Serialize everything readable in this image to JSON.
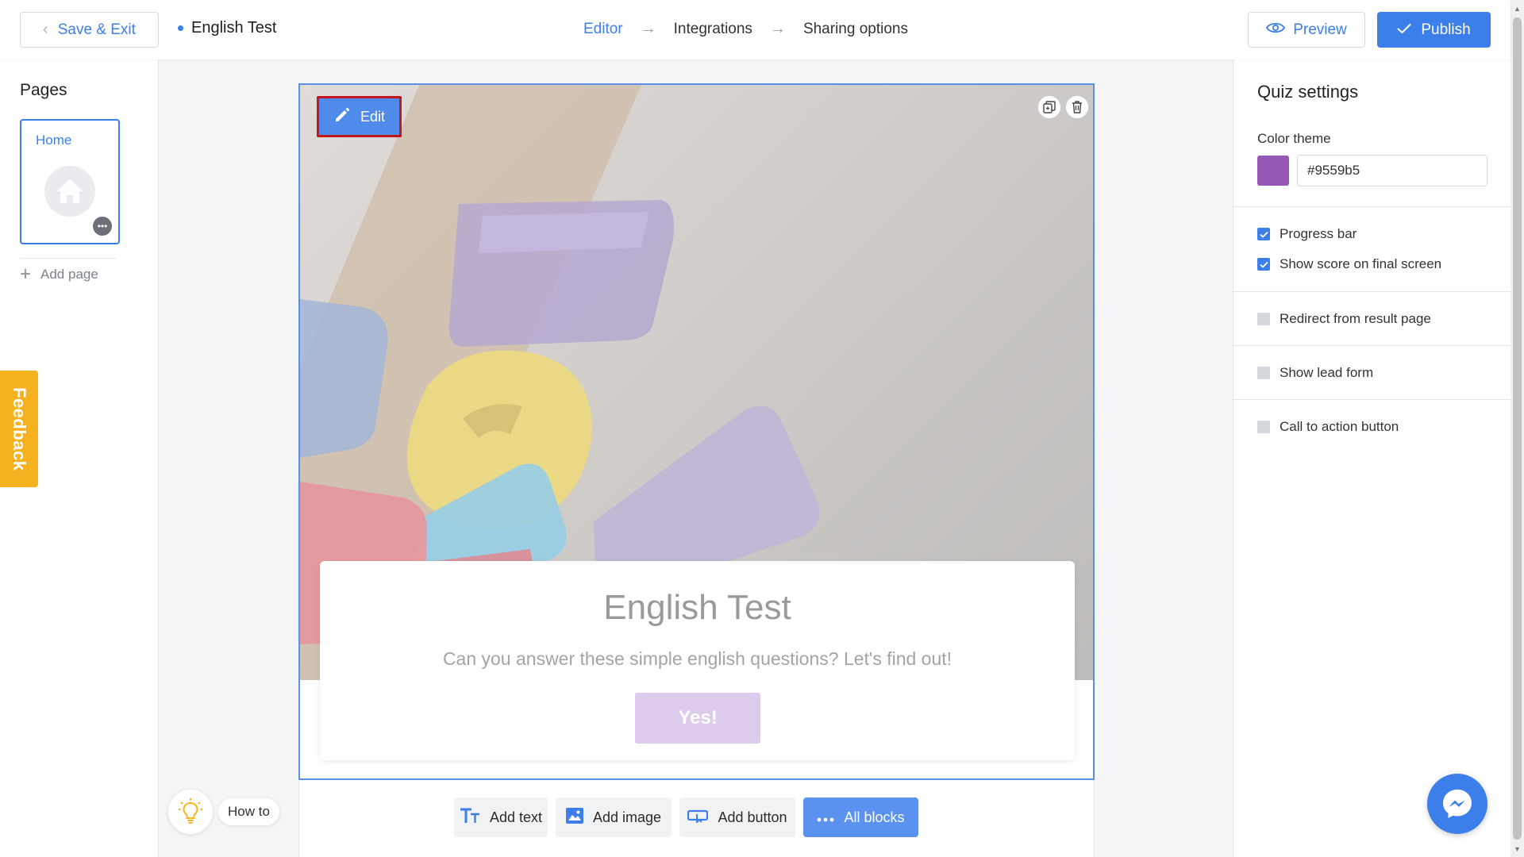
{
  "header": {
    "save_exit": "Save & Exit",
    "quiz_name": "English Test",
    "steps": [
      "Editor",
      "Integrations",
      "Sharing options"
    ],
    "preview": "Preview",
    "publish": "Publish"
  },
  "pages": {
    "title": "Pages",
    "items": [
      {
        "label": "Home"
      }
    ],
    "add_page": "Add page"
  },
  "feedback": "Feedback",
  "howto": "How to",
  "block": {
    "edit": "Edit",
    "title": "English Test",
    "subtitle": "Can you answer these simple english questions? Let's find out!",
    "button": "Yes!"
  },
  "toolbar": {
    "add_text": "Add text",
    "add_image": "Add image",
    "add_button": "Add button",
    "all_blocks": "All blocks"
  },
  "settings": {
    "title": "Quiz settings",
    "color_label": "Color theme",
    "color_value": "#9559b5",
    "options": [
      {
        "label": "Progress bar",
        "checked": true
      },
      {
        "label": "Show score on final screen",
        "checked": true
      },
      {
        "label": "Redirect from result page",
        "checked": false
      },
      {
        "label": "Show lead form",
        "checked": false
      },
      {
        "label": "Call to action button",
        "checked": false
      }
    ]
  },
  "colors": {
    "accent": "#3c7fea",
    "edit_outline": "#c4161c",
    "feedback": "#f6b21e",
    "theme": "#9559b5",
    "yes_button": "#dccbec"
  },
  "icons": {
    "back": "chevron-left-icon",
    "arrow": "arrow-right-icon",
    "preview": "eye-icon",
    "publish": "check-icon",
    "edit": "pencil-icon",
    "duplicate": "duplicate-icon",
    "delete": "trash-icon",
    "home": "home-icon",
    "more": "more-icon",
    "add": "plus-icon",
    "bulb": "lightbulb-icon",
    "text": "text-icon",
    "image": "image-icon",
    "button": "button-icon",
    "blocks": "dots-icon",
    "messenger": "messenger-icon"
  }
}
